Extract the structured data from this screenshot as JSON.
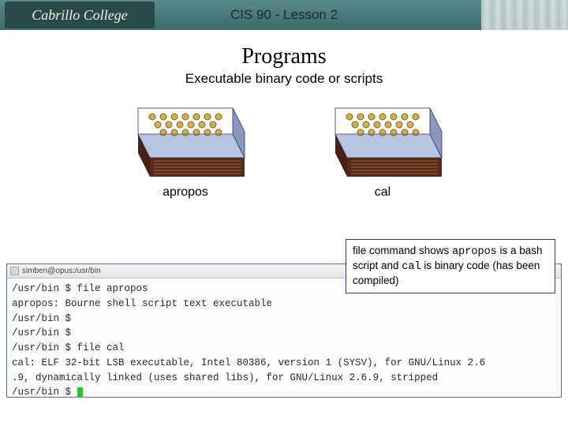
{
  "header": {
    "logo_text": "Cabrillo College",
    "title": "CIS 90 - Lesson 2"
  },
  "page": {
    "title": "Programs",
    "subtitle": "Executable binary code or scripts"
  },
  "boxes": [
    {
      "label": "apropos"
    },
    {
      "label": "cal"
    }
  ],
  "callout": {
    "line1": "file command shows ",
    "mono1": "apropos",
    "mid1": " is a bash script and ",
    "mono2": "cal",
    "tail": " is binary code (has been compiled)"
  },
  "terminal": {
    "title": "simben@opus:/usr/bin",
    "lines": [
      "/usr/bin $ file apropos",
      "apropos: Bourne shell script text executable",
      "/usr/bin $",
      "/usr/bin $",
      "/usr/bin $ file cal",
      "cal: ELF 32-bit LSB executable, Intel 80386, version 1 (SYSV), for GNU/Linux 2.6",
      ".9, dynamically linked (uses shared libs), for GNU/Linux 2.6.9, stripped",
      "/usr/bin $ "
    ]
  }
}
